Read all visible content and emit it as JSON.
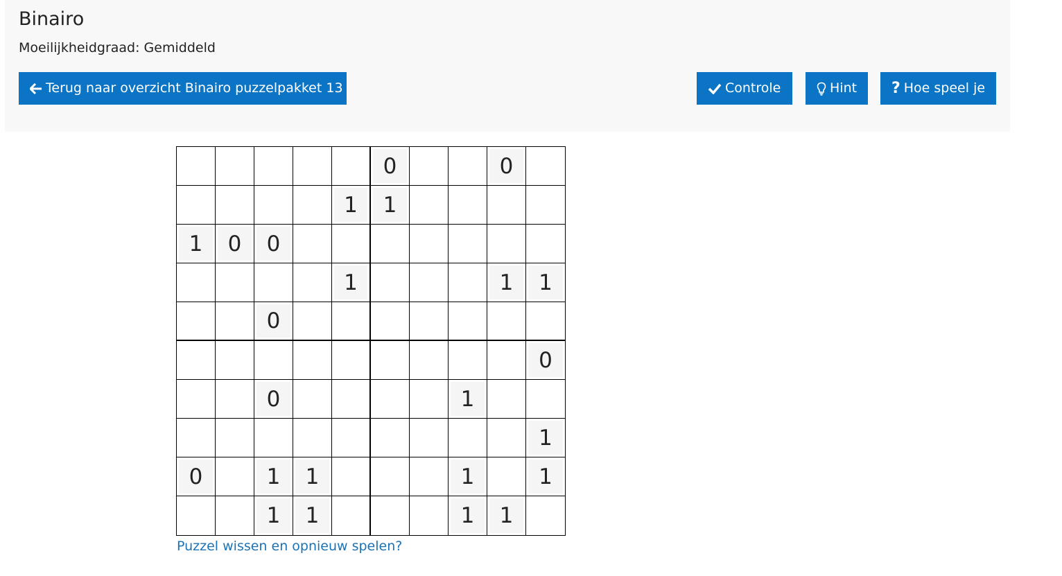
{
  "header": {
    "title": "Binairo",
    "difficulty": "Moeilijkheidgraad: Gemiddeld"
  },
  "buttons": {
    "back": {
      "label": "Terug naar overzicht Binairo puzzelpakket 13",
      "icon": "arrow-left-icon"
    },
    "check": {
      "label": "Controle",
      "icon": "checkmark-icon"
    },
    "hint": {
      "label": "Hint",
      "icon": "lightbulb-icon"
    },
    "howto": {
      "label": "Hoe speel je",
      "icon": "question-icon"
    }
  },
  "board": {
    "size": 10,
    "rows": [
      [
        "",
        "",
        "",
        "",
        "",
        "0",
        "",
        "",
        "0",
        ""
      ],
      [
        "",
        "",
        "",
        "",
        "1",
        "1",
        "",
        "",
        "",
        ""
      ],
      [
        "1",
        "0",
        "0",
        "",
        "",
        "",
        "",
        "",
        "",
        ""
      ],
      [
        "",
        "",
        "",
        "",
        "1",
        "",
        "",
        "",
        "1",
        "1"
      ],
      [
        "",
        "",
        "0",
        "",
        "",
        "",
        "",
        "",
        "",
        ""
      ],
      [
        "",
        "",
        "",
        "",
        "",
        "",
        "",
        "",
        "",
        "0"
      ],
      [
        "",
        "",
        "0",
        "",
        "",
        "",
        "",
        "1",
        "",
        ""
      ],
      [
        "",
        "",
        "",
        "",
        "",
        "",
        "",
        "",
        "",
        "1"
      ],
      [
        "0",
        "",
        "1",
        "1",
        "",
        "",
        "",
        "1",
        "",
        "1"
      ],
      [
        "",
        "",
        "1",
        "1",
        "",
        "",
        "",
        "1",
        "1",
        ""
      ]
    ]
  },
  "footer": {
    "reset_link": "Puzzel wissen en opnieuw spelen?"
  },
  "colors": {
    "button_bg": "#0b74c4",
    "link": "#1a73b8",
    "header_bg": "#f8f8f8"
  }
}
